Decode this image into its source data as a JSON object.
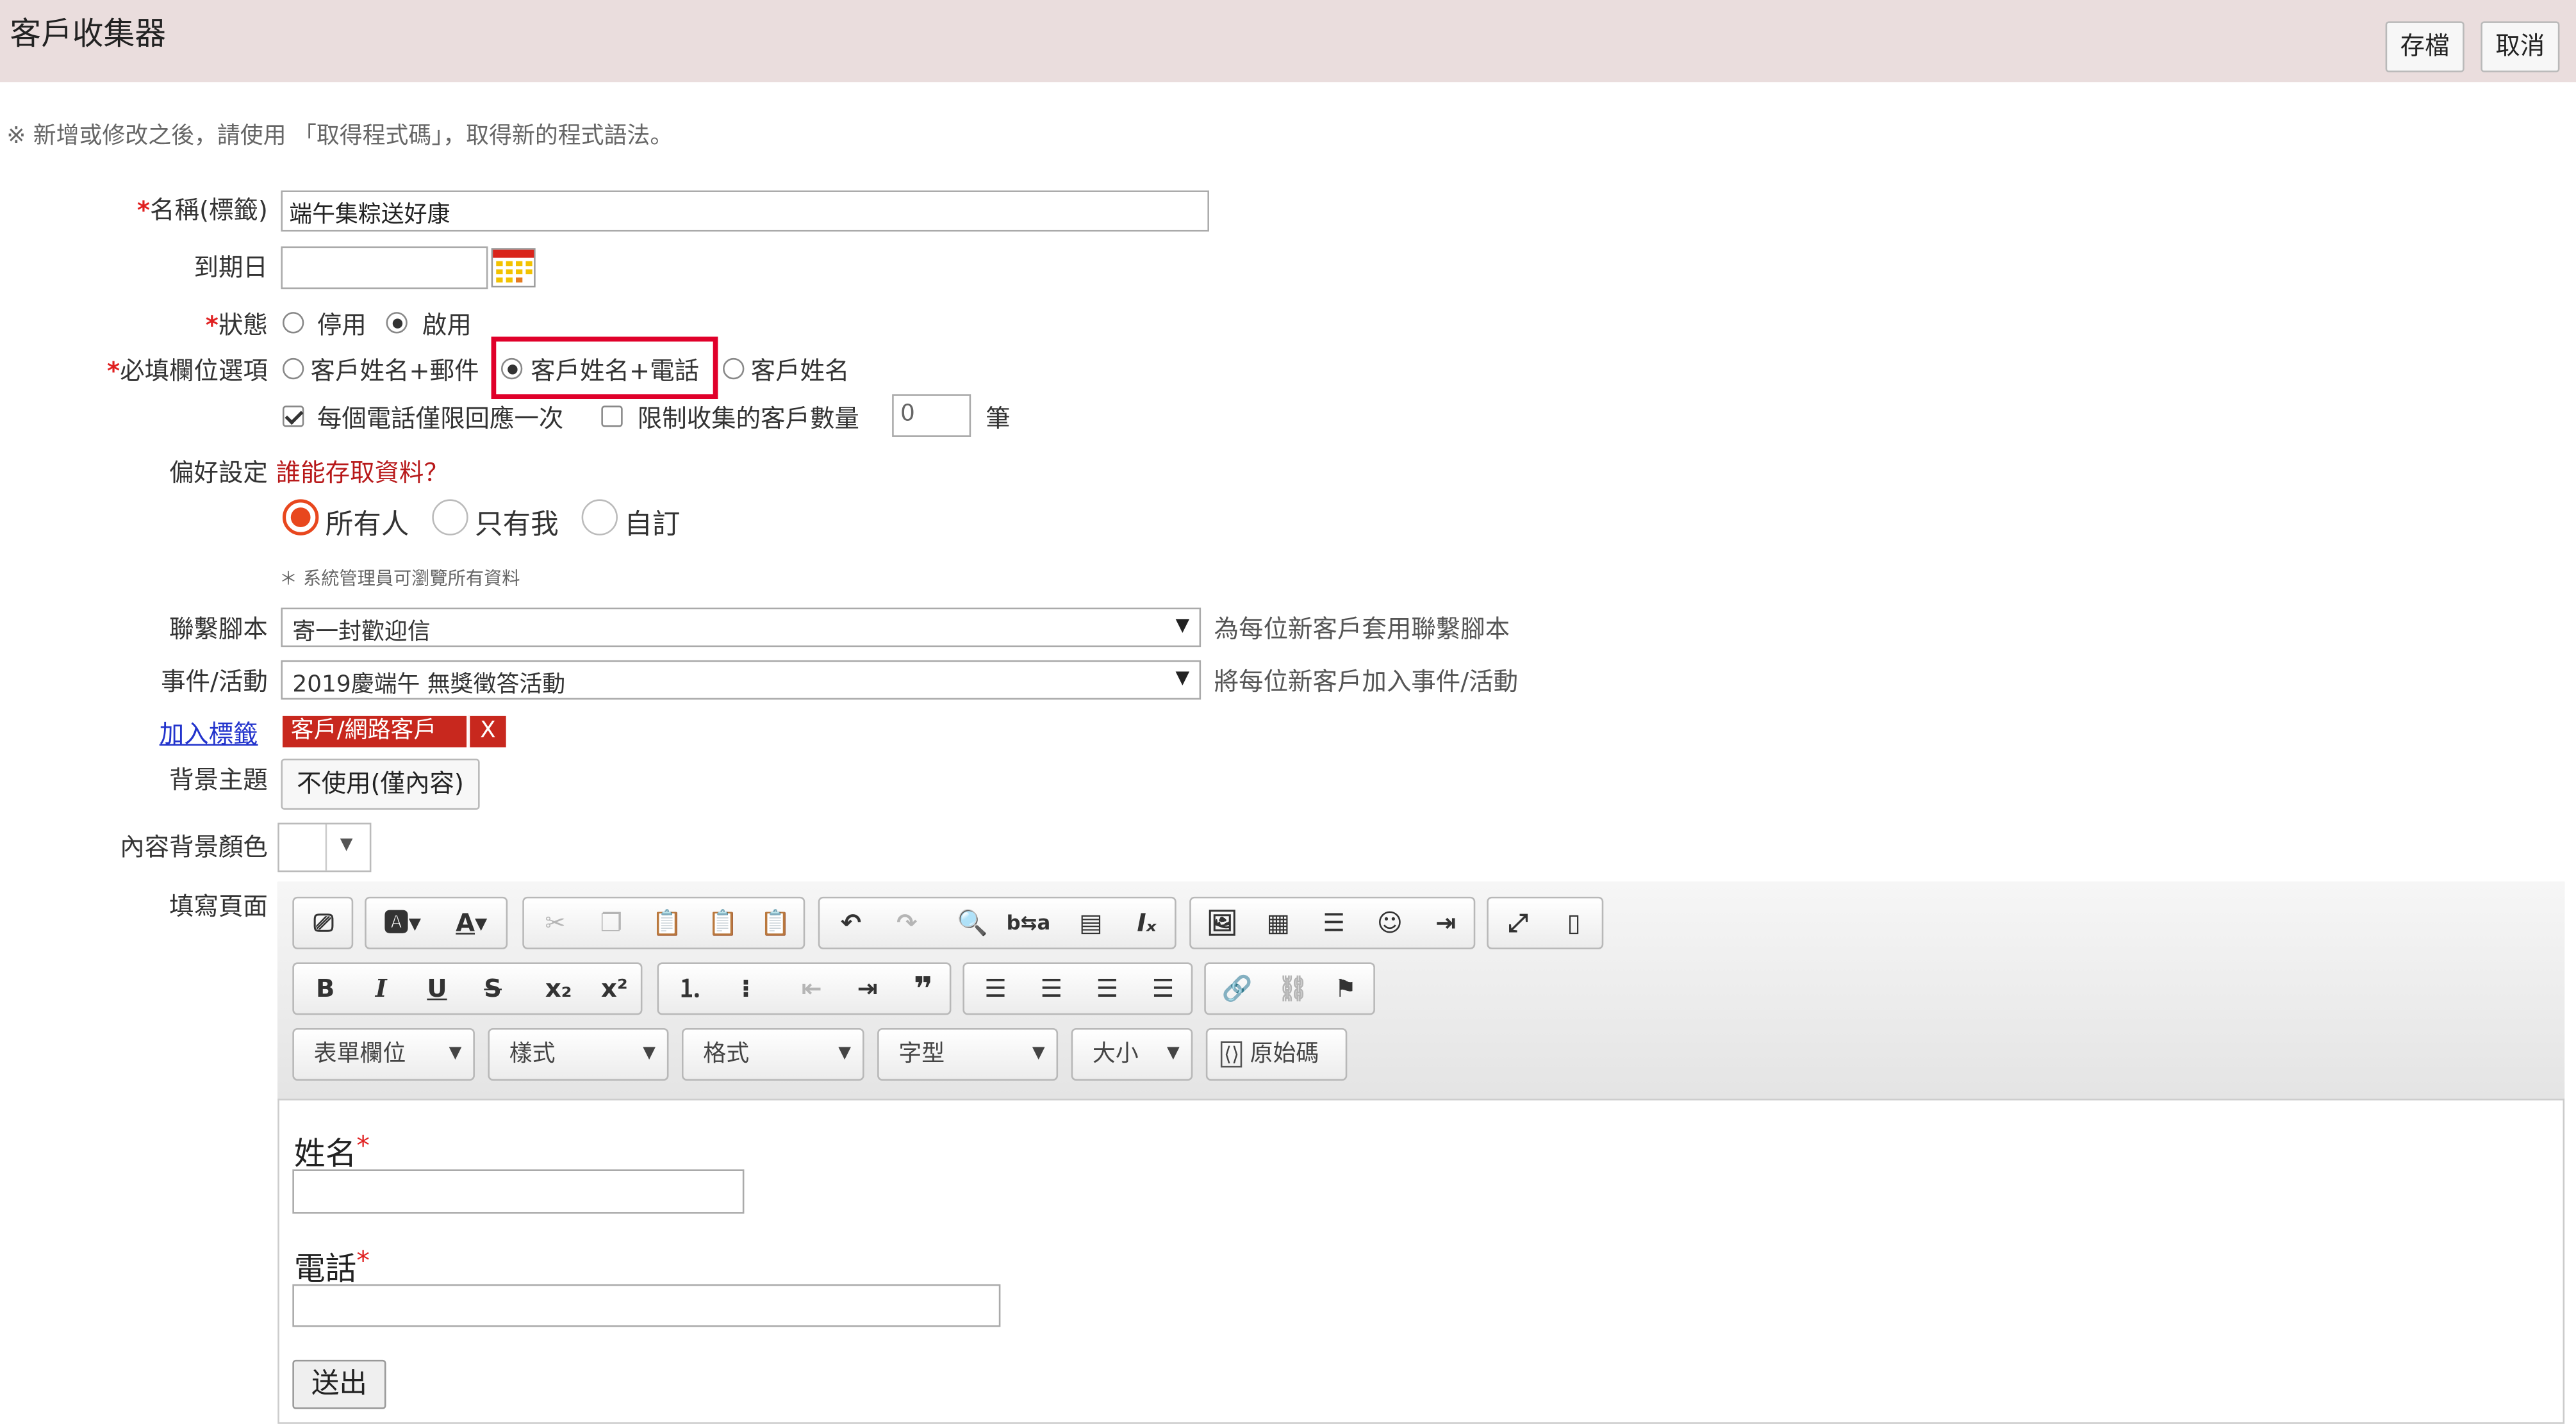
{
  "header": {
    "title": "客戶收集器",
    "save_label": "存檔",
    "cancel_label": "取消"
  },
  "notice": "※ 新增或修改之後，請使用 「取得程式碼」，取得新的程式語法。",
  "form": {
    "name": {
      "label": "名稱(標籤)",
      "value": "端午集粽送好康"
    },
    "expiry": {
      "label": "到期日",
      "value": ""
    },
    "status": {
      "label": "狀態",
      "options": [
        "停用",
        "啟用"
      ],
      "selected": "啟用"
    },
    "required": {
      "label": "必填欄位選項",
      "options": [
        "客戶姓名+郵件",
        "客戶姓名+電話",
        "客戶姓名"
      ],
      "selected": "客戶姓名+電話"
    },
    "once_label": "每個電話僅限回應一次",
    "once_checked": true,
    "limit_label": "限制收集的客戶數量",
    "limit_checked": false,
    "limit_value": "0",
    "limit_unit": "筆",
    "preference": {
      "label": "偏好設定",
      "question": "誰能存取資料？",
      "options": [
        "所有人",
        "只有我",
        "自訂"
      ],
      "selected": "所有人"
    },
    "admin_note": "＊ 系統管理員可瀏覽所有資料",
    "script": {
      "label": "聯繫腳本",
      "value": "寄一封歡迎信",
      "hint": "為每位新客戶套用聯繫腳本"
    },
    "event": {
      "label": "事件/活動",
      "value": "2019慶端午 無獎徵答活動",
      "hint": "將每位新客戶加入事件/活動"
    },
    "tags": {
      "add_label": "加入標籤",
      "items": [
        {
          "text": "客戶/網路客戶",
          "remove": "X"
        }
      ]
    },
    "theme": {
      "label": "背景主題",
      "value": "不使用(僅內容)"
    },
    "bg_color": {
      "label": "內容背景顏色"
    },
    "page": {
      "label": "填寫頁面"
    }
  },
  "editor": {
    "combos": [
      "表單欄位",
      "樣式",
      "格式",
      "字型",
      "大小"
    ],
    "source_label": "原始碼",
    "content": {
      "name_label": "姓名",
      "phone_label": "電話",
      "required_mark": "*",
      "submit_label": "送出"
    }
  },
  "colors": {
    "required": "#e02020",
    "tag": "#c8281e",
    "highlight": "#e0002a",
    "radio_accent": "#e8471e",
    "topbar": "#eadddd"
  }
}
